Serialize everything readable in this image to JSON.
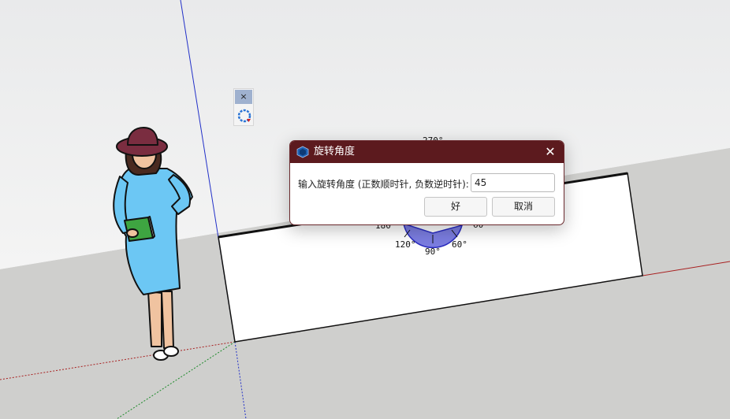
{
  "viewport": {
    "protractor_labels": [
      "270°",
      "180",
      "120°",
      "90°",
      "60°",
      "60"
    ]
  },
  "mini_toolbar": {
    "close_glyph": "×",
    "rotate_tool_icon": "rotate-icon"
  },
  "dialog": {
    "title": "旋转角度",
    "close_glyph": "✕",
    "prompt_label": "输入旋转角度 (正数顺时针, 负数逆时针):",
    "angle_value": "45",
    "ok_label": "好",
    "cancel_label": "取消",
    "accent_color": "#5c1a1e"
  }
}
